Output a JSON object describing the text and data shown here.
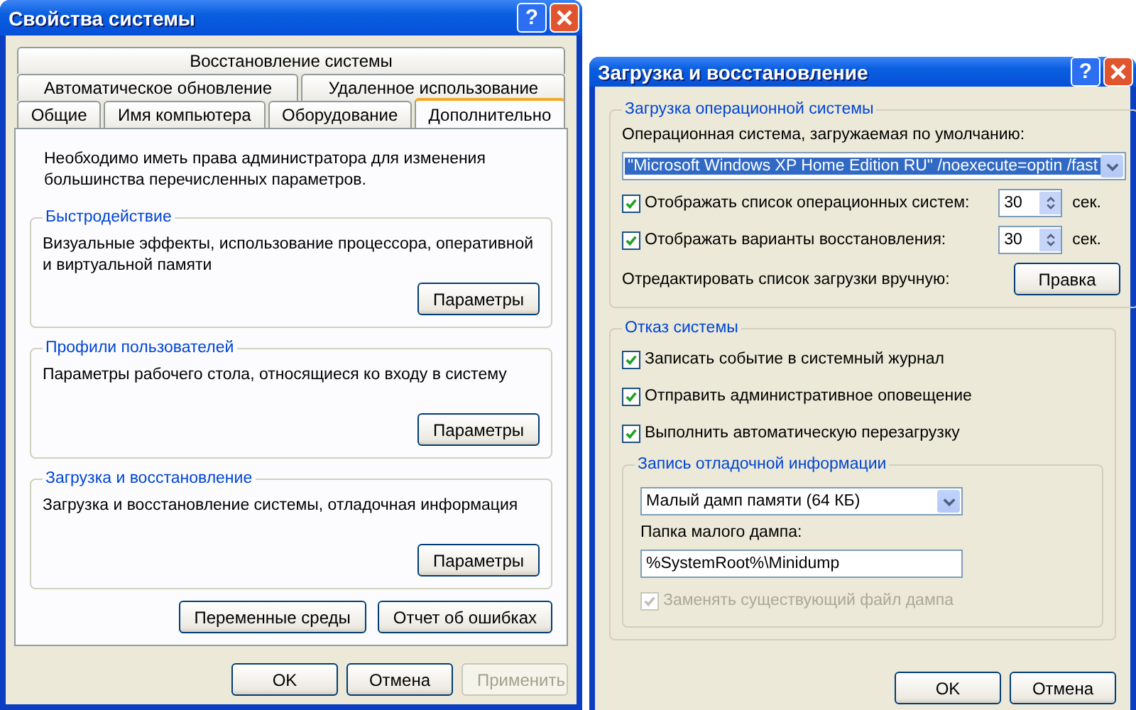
{
  "system_properties": {
    "title": "Свойства системы",
    "help_button": "?",
    "tab_rows": [
      [
        {
          "label": "Восстановление системы",
          "selected": false
        }
      ],
      [
        {
          "label": "Автоматическое обновление",
          "selected": false
        },
        {
          "label": "Удаленное использование",
          "selected": false
        }
      ],
      [
        {
          "label": "Общие",
          "selected": false
        },
        {
          "label": "Имя компьютера",
          "selected": false
        },
        {
          "label": "Оборудование",
          "selected": false
        },
        {
          "label": "Дополнительно",
          "selected": true
        }
      ]
    ],
    "intro": "Необходимо иметь права администратора для изменения большинства перечисленных параметров.",
    "groups": [
      {
        "title": "Быстродействие",
        "description": "Визуальные эффекты, использование процессора, оперативной и виртуальной памяти",
        "button": "Параметры"
      },
      {
        "title": "Профили пользователей",
        "description": "Параметры рабочего стола, относящиеся ко входу в систему",
        "button": "Параметры"
      },
      {
        "title": "Загрузка и восстановление",
        "description": "Загрузка и восстановление системы, отладочная информация",
        "button": "Параметры"
      }
    ],
    "panel_buttons": [
      "Переменные среды",
      "Отчет об ошибках"
    ],
    "footer_buttons": [
      {
        "label": "OK",
        "disabled": false
      },
      {
        "label": "Отмена",
        "disabled": false
      },
      {
        "label": "Применить",
        "disabled": true
      }
    ]
  },
  "startup_recovery": {
    "title": "Загрузка и восстановление",
    "help_button": "?",
    "startup": {
      "title": "Загрузка операционной системы",
      "default_os_label": "Операционная система, загружаемая по умолчанию:",
      "default_os": "\"Microsoft Windows XP Home Edition RU\" /noexecute=optin /fast",
      "options": [
        {
          "label": "Отображать список операционных систем:",
          "checked": true,
          "value": "30",
          "unit": "сек."
        },
        {
          "label": "Отображать варианты восстановления:",
          "checked": true,
          "value": "30",
          "unit": "сек."
        }
      ],
      "edit_label": "Отредактировать список загрузки вручную:",
      "edit_button": "Правка"
    },
    "failure": {
      "title": "Отказ системы",
      "options": [
        {
          "label": "Записать событие в системный журнал",
          "checked": true
        },
        {
          "label": "Отправить административное оповещение",
          "checked": true
        },
        {
          "label": "Выполнить автоматическую перезагрузку",
          "checked": true
        }
      ],
      "debug": {
        "title": "Запись отладочной информации",
        "dump_type": "Малый дамп памяти (64 КБ)",
        "folder_label": "Папка малого дампа:",
        "folder": "%SystemRoot%\\Minidump",
        "overwrite": {
          "label": "Заменять существующий файл дампа",
          "checked": true,
          "disabled": true
        }
      }
    },
    "footer_buttons": [
      {
        "label": "OK",
        "disabled": false
      },
      {
        "label": "Отмена",
        "disabled": false
      }
    ]
  }
}
